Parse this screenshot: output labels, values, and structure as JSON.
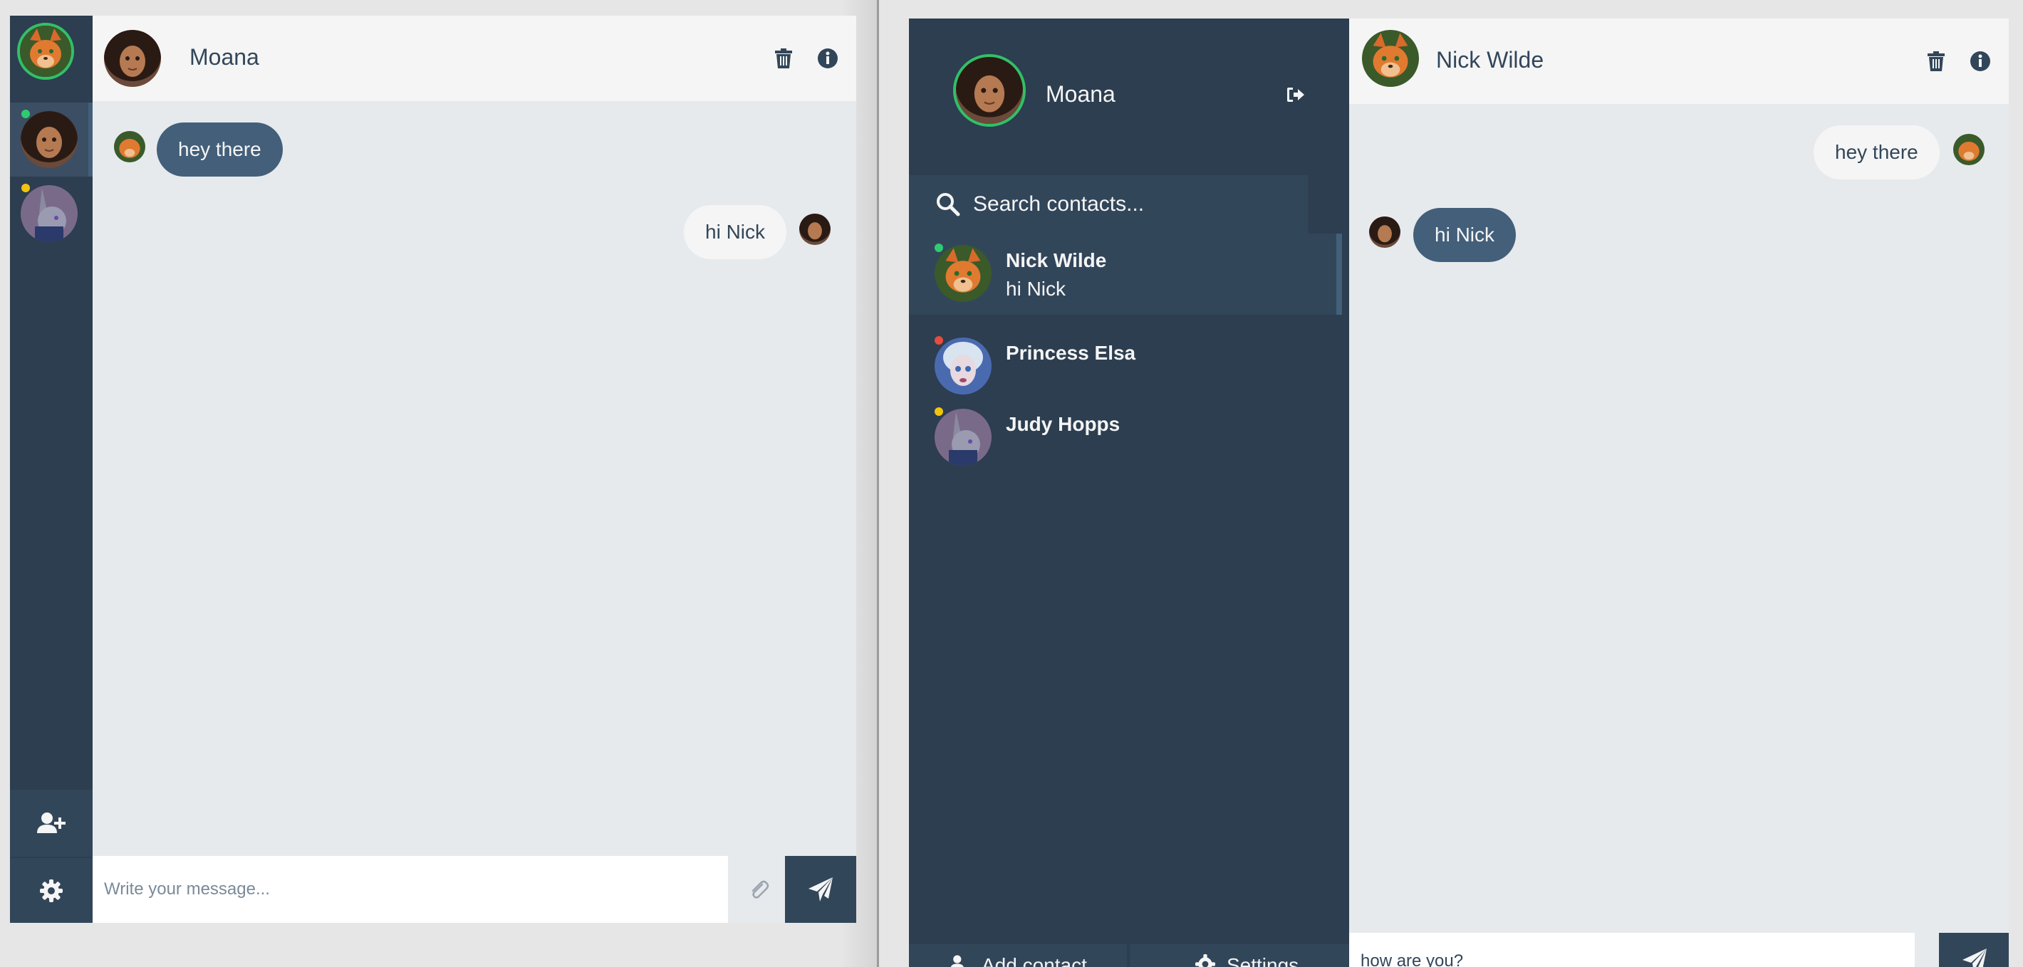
{
  "left_window": {
    "header": {
      "contact_name": "Moana"
    },
    "messages": [
      {
        "direction": "received",
        "text": "hey there"
      },
      {
        "direction": "sent",
        "text": "hi Nick"
      }
    ],
    "composer": {
      "placeholder": "Write your message..."
    },
    "rail": {
      "contacts": [
        {
          "status_color": "#2ecc71",
          "avatar": "moana-avatar"
        },
        {
          "status_color": "#f1c40f",
          "avatar": "judy-hopps-avatar"
        }
      ],
      "icons": [
        "add-contact-icon",
        "settings-icon"
      ]
    }
  },
  "right_window": {
    "profile": {
      "name": "Moana",
      "status_color": "#2ecc71"
    },
    "search": {
      "placeholder": "Search contacts..."
    },
    "contacts": [
      {
        "name": "Nick Wilde",
        "preview": "hi Nick",
        "status_color": "#2ecc71",
        "avatar": "nick-wilde-avatar"
      },
      {
        "name": "Princess Elsa",
        "preview": "",
        "status_color": "#e74c3c",
        "avatar": "princess-elsa-avatar"
      },
      {
        "name": "Judy Hopps",
        "preview": "",
        "status_color": "#f1c40f",
        "avatar": "judy-hopps-avatar"
      }
    ],
    "bottom": {
      "add_contact_label": "Add contact",
      "settings_label": "Settings"
    },
    "header": {
      "contact_name": "Nick Wilde"
    },
    "messages": [
      {
        "direction": "sent",
        "text": "hey there"
      },
      {
        "direction": "received",
        "text": "hi Nick"
      }
    ],
    "composer": {
      "value": "how are you?"
    }
  },
  "colors": {
    "sidebar": "#2c3e50",
    "sidebar_light": "#32465a",
    "accent": "#435f7a",
    "background": "#e6eaed",
    "online": "#2ecc71",
    "away": "#f1c40f",
    "busy": "#e74c3c"
  }
}
